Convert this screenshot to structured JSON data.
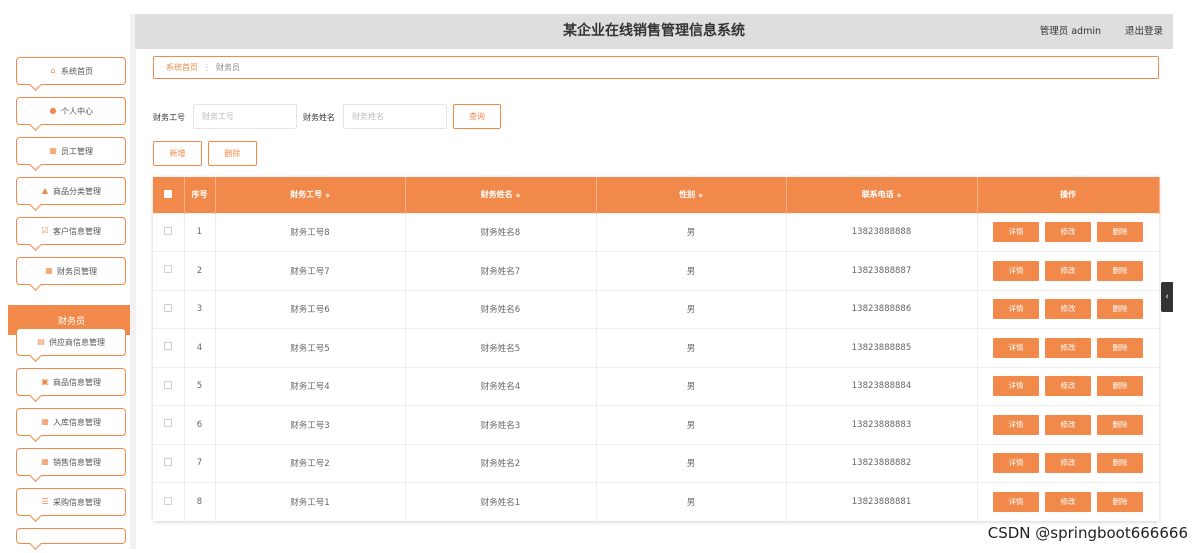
{
  "header": {
    "title": "某企业在线销售管理信息系统",
    "user": "管理员 admin",
    "logout": "退出登录"
  },
  "sidebar": {
    "items": [
      {
        "label": "系统首页",
        "icon": "home-icon"
      },
      {
        "label": "个人中心",
        "icon": "user-icon"
      },
      {
        "label": "员工管理",
        "icon": "grid-icon"
      },
      {
        "label": "商品分类管理",
        "icon": "thumb-icon"
      },
      {
        "label": "客户信息管理",
        "icon": "check-icon"
      },
      {
        "label": "财务员管理",
        "icon": "grid-icon"
      },
      {
        "label": "供应商信息管理",
        "icon": "table-icon"
      },
      {
        "label": "商品信息管理",
        "icon": "clipboard-icon"
      },
      {
        "label": "入库信息管理",
        "icon": "grid-icon"
      },
      {
        "label": "销售信息管理",
        "icon": "grid-icon"
      },
      {
        "label": "采购信息管理",
        "icon": "list-icon"
      }
    ],
    "active_sub": "财务员"
  },
  "breadcrumb": {
    "home": "系统首页",
    "separator": "⋮",
    "current": "财务员"
  },
  "search": {
    "id_label": "财务工号",
    "id_placeholder": "财务工号",
    "name_label": "财务姓名",
    "name_placeholder": "财务姓名",
    "query_button": "查询"
  },
  "actions": {
    "add": "新增",
    "delete": "删除"
  },
  "table": {
    "headers": {
      "index": "序号",
      "staff_id": "财务工号",
      "staff_name": "财务姓名",
      "gender": "性别",
      "phone": "联系电话",
      "ops": "操作"
    },
    "op_labels": {
      "detail": "详情",
      "edit": "修改",
      "delete": "删除"
    },
    "rows": [
      {
        "index": "1",
        "staff_id": "财务工号8",
        "staff_name": "财务姓名8",
        "gender": "男",
        "phone": "13823888888"
      },
      {
        "index": "2",
        "staff_id": "财务工号7",
        "staff_name": "财务姓名7",
        "gender": "男",
        "phone": "13823888887"
      },
      {
        "index": "3",
        "staff_id": "财务工号6",
        "staff_name": "财务姓名6",
        "gender": "男",
        "phone": "13823888886"
      },
      {
        "index": "4",
        "staff_id": "财务工号5",
        "staff_name": "财务姓名5",
        "gender": "男",
        "phone": "13823888885"
      },
      {
        "index": "5",
        "staff_id": "财务工号4",
        "staff_name": "财务姓名4",
        "gender": "男",
        "phone": "13823888884"
      },
      {
        "index": "6",
        "staff_id": "财务工号3",
        "staff_name": "财务姓名3",
        "gender": "男",
        "phone": "13823888883"
      },
      {
        "index": "7",
        "staff_id": "财务工号2",
        "staff_name": "财务姓名2",
        "gender": "男",
        "phone": "13823888882"
      },
      {
        "index": "8",
        "staff_id": "财务工号1",
        "staff_name": "财务姓名1",
        "gender": "男",
        "phone": "13823888881"
      }
    ]
  },
  "watermark": "CSDN @springboot666666",
  "colors": {
    "accent": "#f0894a",
    "header_bg": "#dedede"
  }
}
